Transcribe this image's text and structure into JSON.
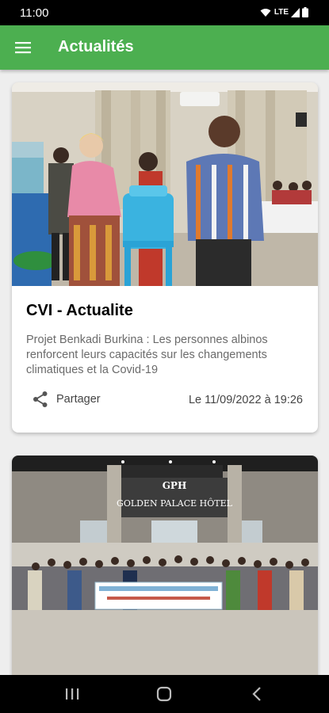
{
  "status_bar": {
    "time": "11:00",
    "network": "LTE",
    "icons": [
      "wifi-icon",
      "signal-icon",
      "battery-icon"
    ]
  },
  "app_bar": {
    "title": "Actualités",
    "menu_icon": "hamburger-menu-icon"
  },
  "articles": [
    {
      "category": "CVI - Actualite",
      "description": "Projet Benkadi Burkina : Les personnes albinos renforcent leurs capacités sur les changements climatiques et la Covid-19",
      "share_label": "Partager",
      "date": "Le 11/09/2022 à 19:26",
      "image": "photo-handover-of-water-container"
    },
    {
      "image": "photo-group-in-front-of-golden-palace-hotel",
      "hotel_sign": "GOLDEN PALACE HÔTEL",
      "hotel_sign_initials": "GPH"
    }
  ],
  "nav_bar": {
    "icons": [
      "recent-apps-icon",
      "home-icon",
      "back-icon"
    ]
  },
  "colors": {
    "app_bar": "#4caf50",
    "status_bar": "#000000",
    "background": "#eeeeee",
    "card": "#ffffff"
  }
}
